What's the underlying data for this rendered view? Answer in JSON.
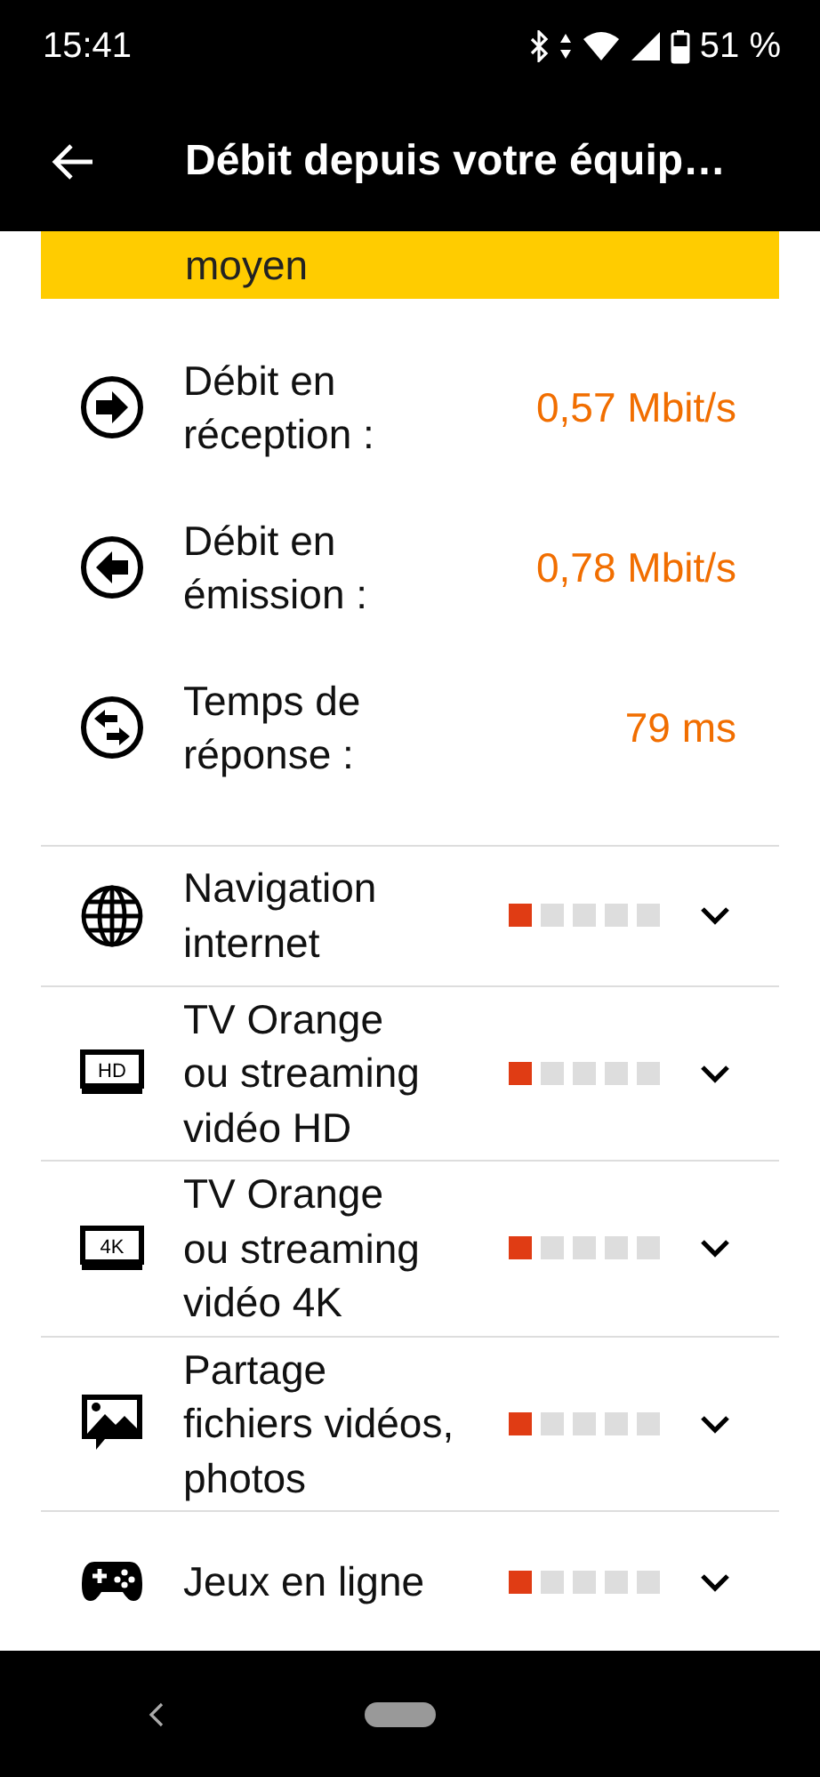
{
  "status_bar": {
    "time": "15:41",
    "battery": "51 %"
  },
  "app_bar": {
    "title": "Débit depuis votre équip…"
  },
  "banner": {
    "text": "moyen"
  },
  "metrics": [
    {
      "kind": "reception",
      "label": "Débit en réception :",
      "value": "0,57 Mbit/s"
    },
    {
      "kind": "emission",
      "label": "Débit en émission :",
      "value": "0,78 Mbit/s"
    },
    {
      "kind": "response",
      "label": "Temps de réponse :",
      "value": "79 ms"
    }
  ],
  "services": [
    {
      "kind": "globe",
      "label": "Navigation internet",
      "level": 0.2,
      "expanded": false
    },
    {
      "kind": "tv",
      "icon_label": "HD",
      "label": "TV Orange\nou streaming\nvidéo HD",
      "level": 0.2,
      "expanded": false
    },
    {
      "kind": "tv",
      "icon_label": "4K",
      "label": "TV Orange\nou streaming\nvidéo 4K",
      "level": 0.2,
      "expanded": false
    },
    {
      "kind": "image",
      "label": "Partage\nfichiers vidéos,\nphotos",
      "level": 0.2,
      "expanded": false
    },
    {
      "kind": "gamepad",
      "label": "Jeux en ligne",
      "level": 0.2,
      "expanded": false
    }
  ]
}
